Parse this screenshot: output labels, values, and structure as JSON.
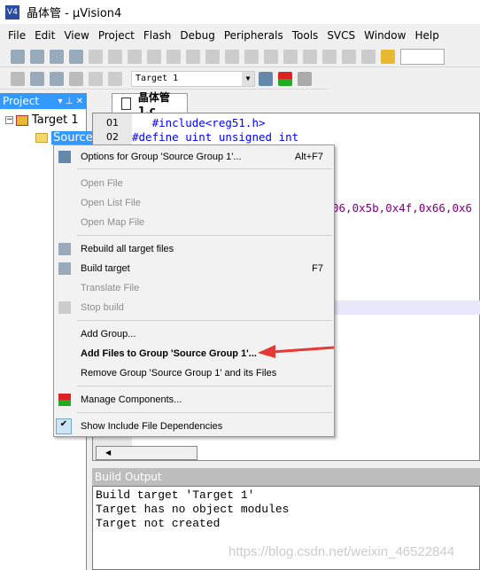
{
  "window": {
    "title": "晶体管  - µVision4"
  },
  "menubar": [
    "File",
    "Edit",
    "View",
    "Project",
    "Flash",
    "Debug",
    "Peripherals",
    "Tools",
    "SVCS",
    "Window",
    "Help"
  ],
  "toolbar": {
    "target": "Target 1"
  },
  "project": {
    "title": "Project",
    "controls": [
      "▾",
      "⊥",
      "✕"
    ],
    "tree": {
      "target": "Target 1",
      "group": "Source"
    }
  },
  "editor": {
    "tab": "晶体管1.c",
    "lines": [
      {
        "n": "01",
        "text": "   #include<reg51.h>"
      },
      {
        "n": "02",
        "text": "#define uint unsigned int"
      }
    ],
    "visible_fragment": "06,0x5b,0x4f,0x66,0x6"
  },
  "context_menu": {
    "items": [
      {
        "label": "Options for Group 'Source Group 1'...",
        "shortcut": "Alt+F7",
        "disabled": false,
        "icon": "wand-icon"
      },
      {
        "label": "Open File",
        "disabled": true
      },
      {
        "label": "Open List File",
        "disabled": true
      },
      {
        "label": "Open Map File",
        "disabled": true
      },
      {
        "label": "Rebuild all target files",
        "disabled": false,
        "icon": "rebuild-icon"
      },
      {
        "label": "Build target",
        "shortcut": "F7",
        "disabled": false,
        "icon": "build-icon"
      },
      {
        "label": "Translate File",
        "disabled": true
      },
      {
        "label": "Stop build",
        "disabled": true,
        "icon": "stop-build-icon"
      },
      {
        "label": "Add Group...",
        "disabled": false
      },
      {
        "label": "Add Files to Group 'Source Group 1'...",
        "disabled": false,
        "bold": true
      },
      {
        "label": "Remove Group 'Source Group 1' and its Files",
        "disabled": false
      },
      {
        "label": "Manage Components...",
        "disabled": false,
        "icon": "components-icon"
      },
      {
        "label": "Show Include File Dependencies",
        "disabled": false,
        "checked": true
      }
    ]
  },
  "build_output": {
    "title": "Build Output",
    "lines": [
      "Build target 'Target 1'",
      "Target has no object modules",
      "Target not created"
    ]
  },
  "watermark": "https://blog.csdn.net/weixin_46522844",
  "colors": {
    "accent": "#3399ff",
    "arrow": "#e53935",
    "keyword": "#0000ff",
    "hex_literal": "#800080"
  }
}
